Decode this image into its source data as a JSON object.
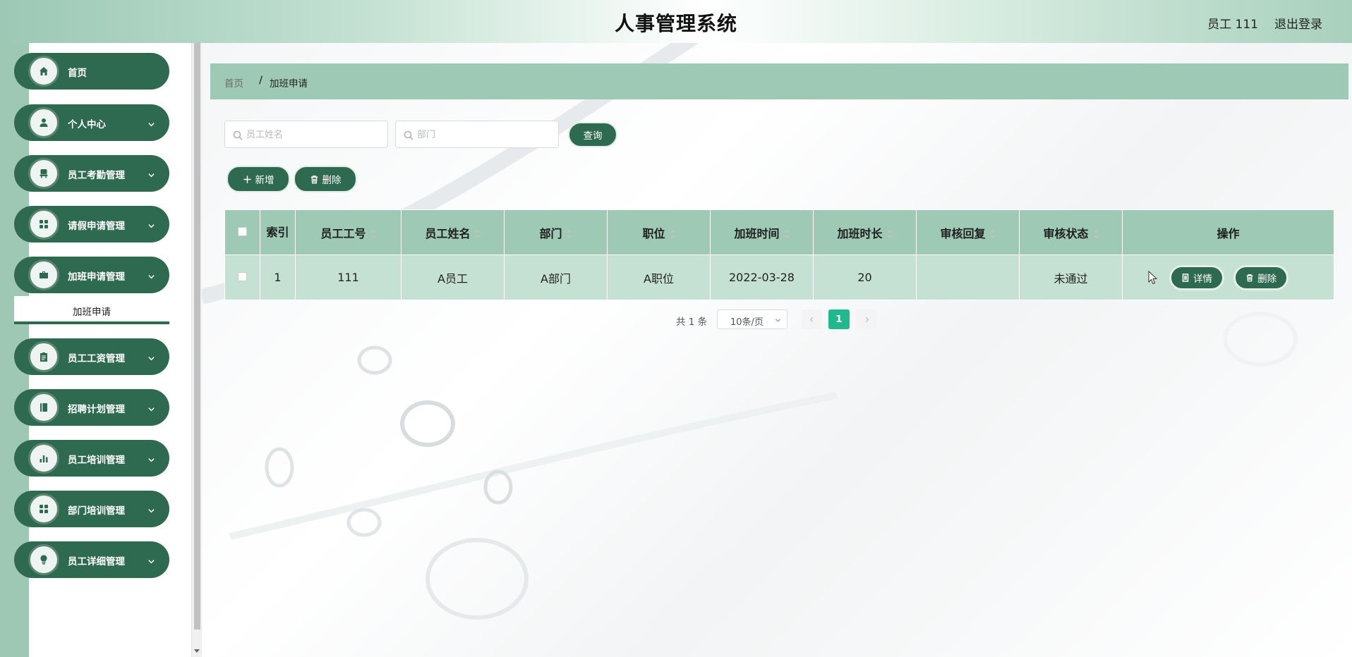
{
  "header": {
    "title": "人事管理系统",
    "user": "员工 111",
    "logout": "退出登录"
  },
  "sidebar": {
    "items": [
      {
        "label": "首页",
        "icon": "home-icon",
        "has_children": false
      },
      {
        "label": "个人中心",
        "icon": "user-icon",
        "has_children": true
      },
      {
        "label": "员工考勤管理",
        "icon": "chair-icon",
        "has_children": true
      },
      {
        "label": "请假申请管理",
        "icon": "grid-icon",
        "has_children": true
      },
      {
        "label": "加班申请管理",
        "icon": "briefcase-icon",
        "has_children": true
      },
      {
        "label": "员工工资管理",
        "icon": "clipboard-icon",
        "has_children": true
      },
      {
        "label": "招聘计划管理",
        "icon": "book-icon",
        "has_children": true
      },
      {
        "label": "员工培训管理",
        "icon": "bar-chart-icon",
        "has_children": true
      },
      {
        "label": "部门培训管理",
        "icon": "grid-icon",
        "has_children": true
      },
      {
        "label": "员工详细管理",
        "icon": "bulb-icon",
        "has_children": true
      }
    ],
    "active_sub": "加班申请"
  },
  "breadcrumb": {
    "home": "首页",
    "separator": "/",
    "current": "加班申请"
  },
  "search": {
    "name_placeholder": "员工姓名",
    "dept_placeholder": "部门",
    "query_label": "查询"
  },
  "actions": {
    "add_label": "新增",
    "delete_label": "删除"
  },
  "table": {
    "columns": [
      "索引",
      "员工工号",
      "员工姓名",
      "部门",
      "职位",
      "加班时间",
      "加班时长",
      "审核回复",
      "审核状态",
      "操作"
    ],
    "rows": [
      {
        "index": "1",
        "employee_no": "111",
        "employee_name": "A员工",
        "department": "A部门",
        "position": "A职位",
        "overtime_date": "2022-03-28",
        "overtime_hours": "20",
        "review_reply": "",
        "review_status": "未通过",
        "detail_label": "详情",
        "delete_label": "删除"
      }
    ]
  },
  "pagination": {
    "total": "共 1 条",
    "page_size": "10条/页",
    "current_page": "1"
  },
  "colors": {
    "brand_dark": "#2e6a50",
    "brand_light": "#9dc9b5",
    "row_bg": "#c5e1d4",
    "page_active": "#1fb98d"
  }
}
